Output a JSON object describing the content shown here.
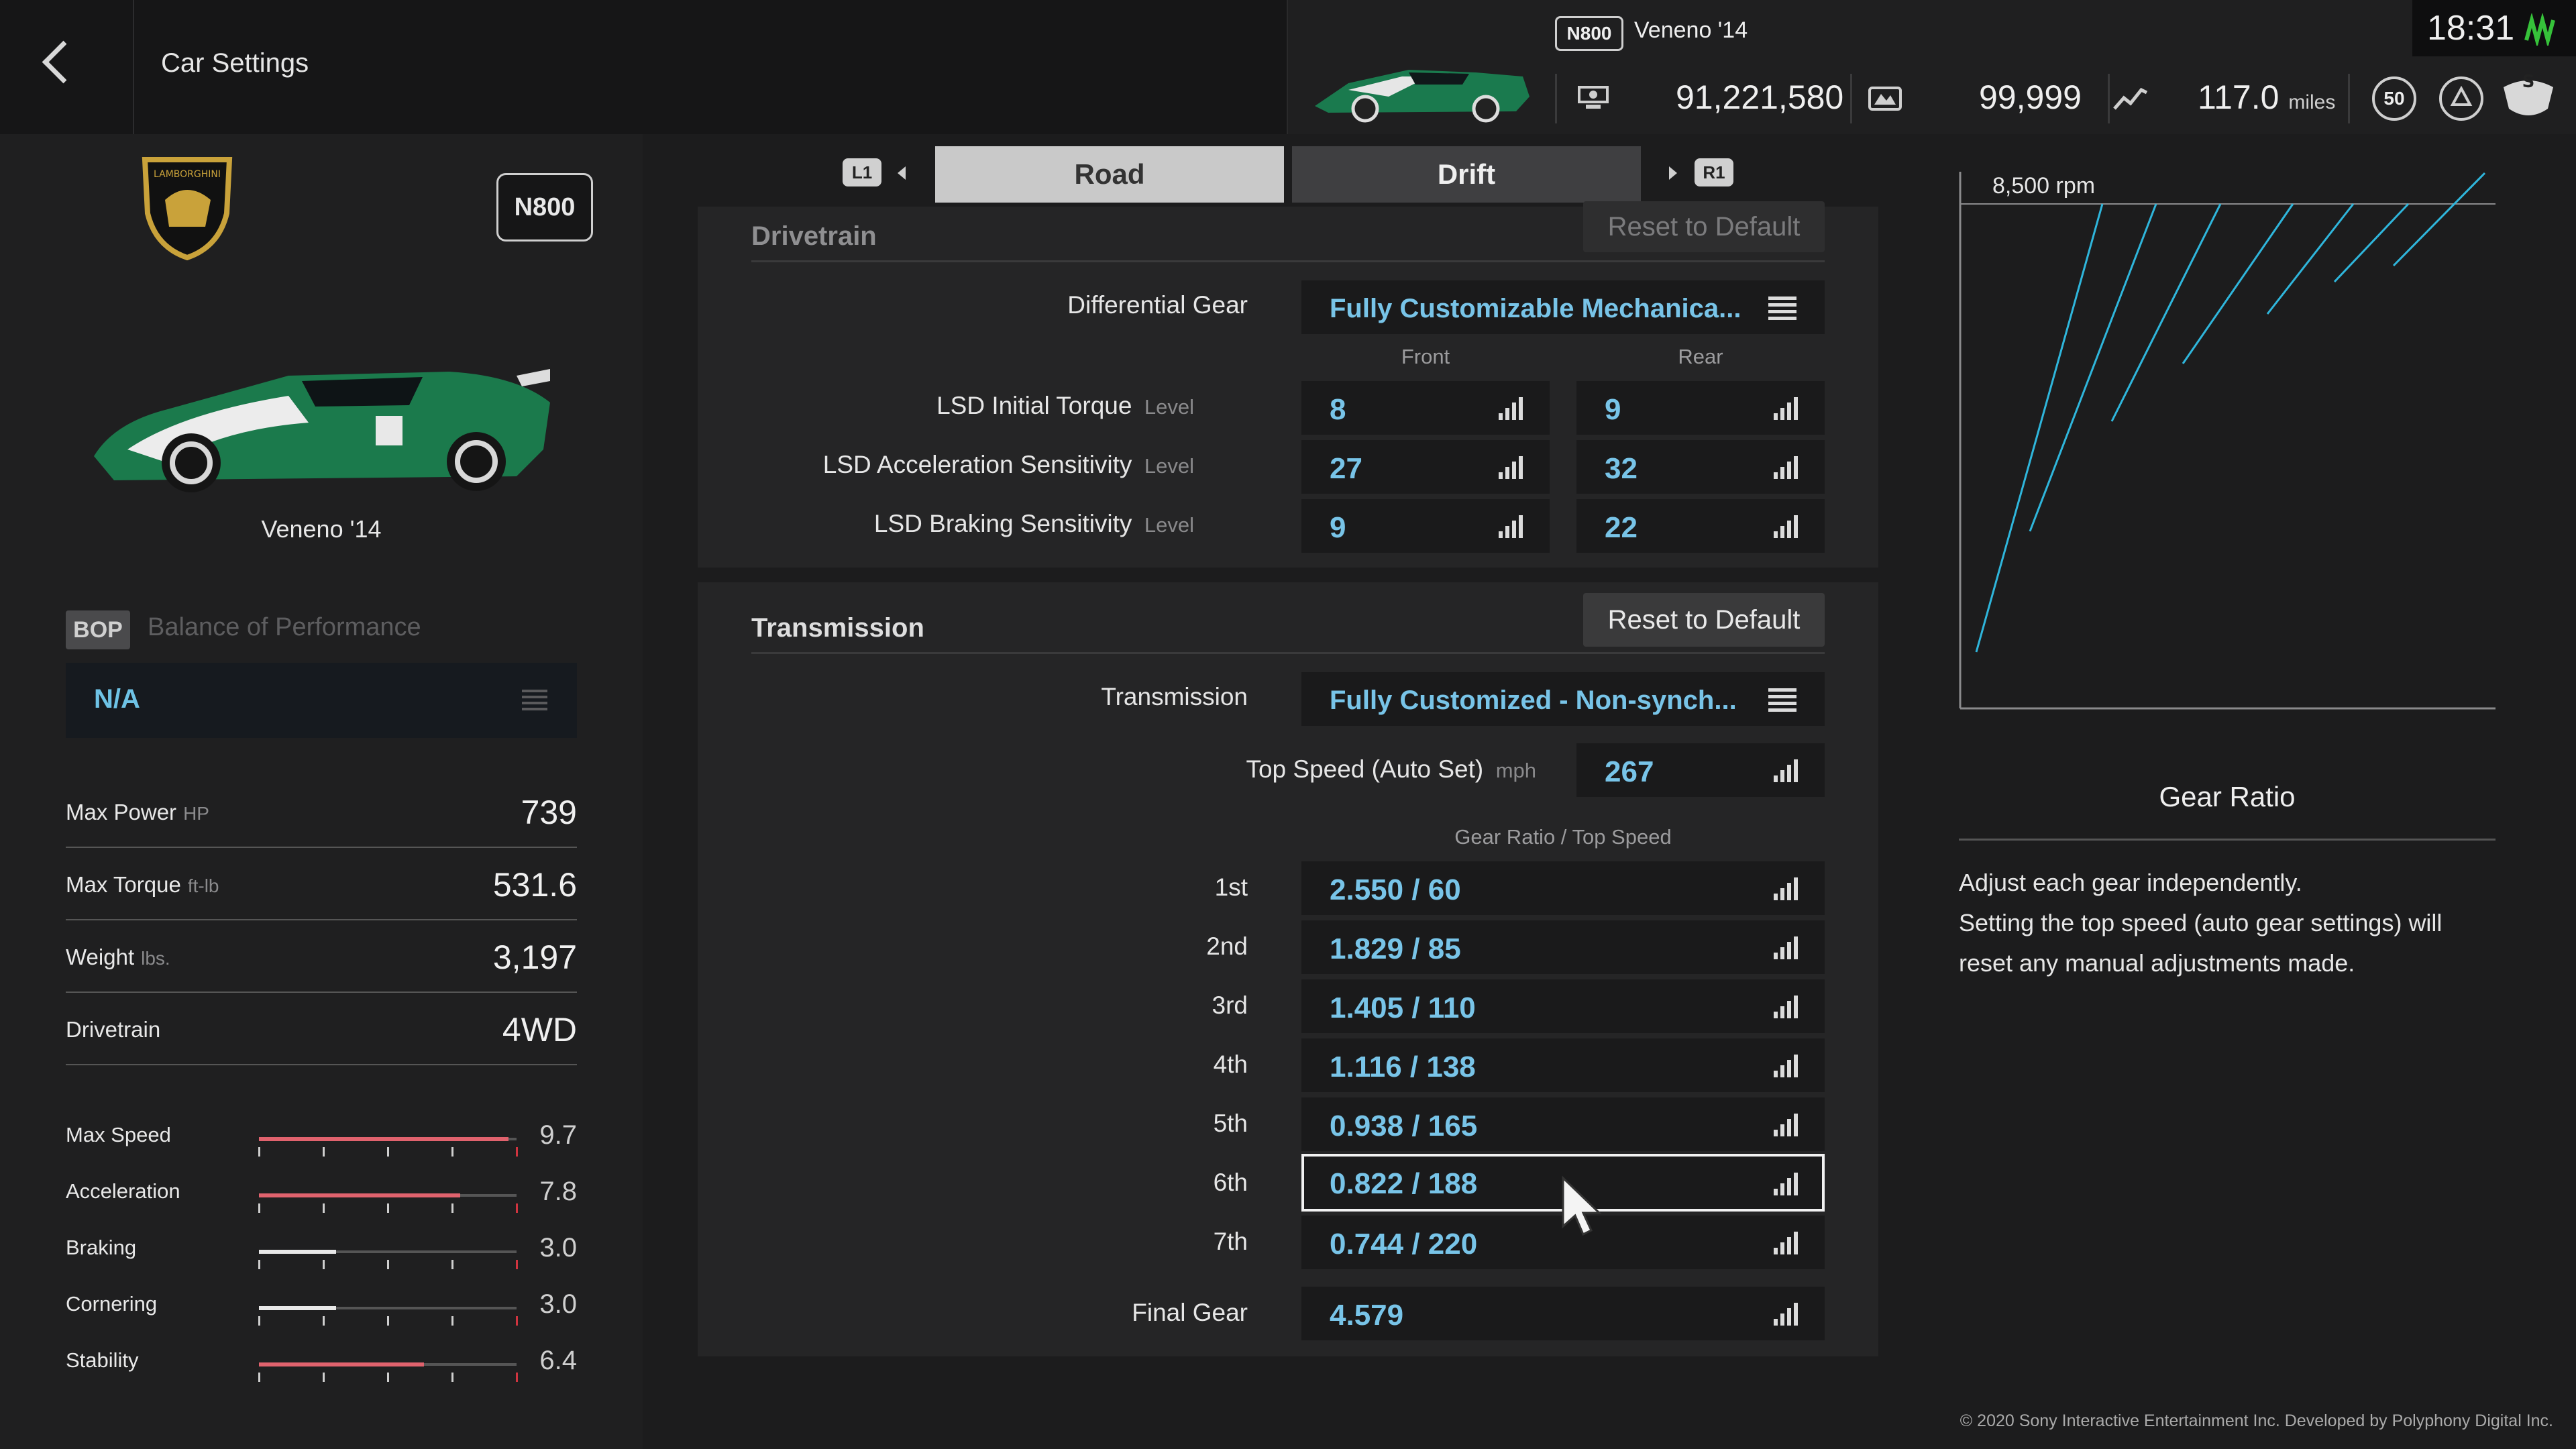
{
  "header": {
    "title": "Car Settings",
    "car_class": "N800",
    "car_name": "Veneno '14",
    "credits": "91,221,580",
    "mileage_points": "99,999",
    "distance": "117.0",
    "distance_unit": "miles",
    "level": "50",
    "time": "18:31"
  },
  "car": {
    "class_badge": "N800",
    "name": "Veneno '14"
  },
  "bop": {
    "tag": "BOP",
    "label": "Balance of Performance",
    "value": "N/A"
  },
  "specs": [
    {
      "label": "Max Power",
      "unit": "HP",
      "value": "739"
    },
    {
      "label": "Max Torque",
      "unit": "ft-lb",
      "value": "531.6"
    },
    {
      "label": "Weight",
      "unit": "lbs.",
      "value": "3,197"
    },
    {
      "label": "Drivetrain",
      "unit": "",
      "value": "4WD"
    }
  ],
  "ratings": [
    {
      "label": "Max Speed",
      "value": "9.7",
      "fraction": 0.97,
      "color": "#e0626d"
    },
    {
      "label": "Acceleration",
      "value": "7.8",
      "fraction": 0.78,
      "color": "#e0626d"
    },
    {
      "label": "Braking",
      "value": "3.0",
      "fraction": 0.3,
      "color": "#e8e8e8"
    },
    {
      "label": "Cornering",
      "value": "3.0",
      "fraction": 0.3,
      "color": "#e8e8e8"
    },
    {
      "label": "Stability",
      "value": "6.4",
      "fraction": 0.64,
      "color": "#e0626d"
    }
  ],
  "tabs": {
    "l1": "L1",
    "r1": "R1",
    "road": "Road",
    "drift": "Drift"
  },
  "drivetrain": {
    "title": "Drivetrain",
    "reset_label": "Reset to Default",
    "differential_label": "Differential Gear",
    "differential_value": "Fully Customizable Mechanica...",
    "col_front": "Front",
    "col_rear": "Rear",
    "level_unit": "Level",
    "rows": [
      {
        "label": "LSD Initial Torque",
        "front": "8",
        "rear": "9"
      },
      {
        "label": "LSD Acceleration Sensitivity",
        "front": "27",
        "rear": "32"
      },
      {
        "label": "LSD Braking Sensitivity",
        "front": "9",
        "rear": "22"
      }
    ]
  },
  "transmission": {
    "title": "Transmission",
    "reset_label": "Reset to Default",
    "type_label": "Transmission",
    "type_value": "Fully Customized - Non-synch...",
    "top_speed_label": "Top Speed (Auto Set)",
    "top_speed_unit": "mph",
    "top_speed_value": "267",
    "gear_header": "Gear Ratio / Top Speed",
    "gears": [
      {
        "label": "1st",
        "value": "2.550 / 60"
      },
      {
        "label": "2nd",
        "value": "1.829 / 85"
      },
      {
        "label": "3rd",
        "value": "1.405 / 110"
      },
      {
        "label": "4th",
        "value": "1.116 / 138"
      },
      {
        "label": "5th",
        "value": "0.938 / 165"
      },
      {
        "label": "6th",
        "value": "0.822 / 188"
      },
      {
        "label": "7th",
        "value": "0.744 / 220"
      }
    ],
    "final_gear_label": "Final Gear",
    "final_gear_value": "4.579"
  },
  "graph": {
    "rpm_label": "8,500 rpm",
    "line_color": "#2fb6dc"
  },
  "info": {
    "title": "Gear Ratio",
    "description_1": "Adjust each gear independently.",
    "description_2": "Setting the top speed (auto gear settings) will reset any manual adjustments made."
  },
  "footer": {
    "copyright": "© 2020 Sony Interactive Entertainment Inc. Developed by Polyphony Digital Inc."
  }
}
